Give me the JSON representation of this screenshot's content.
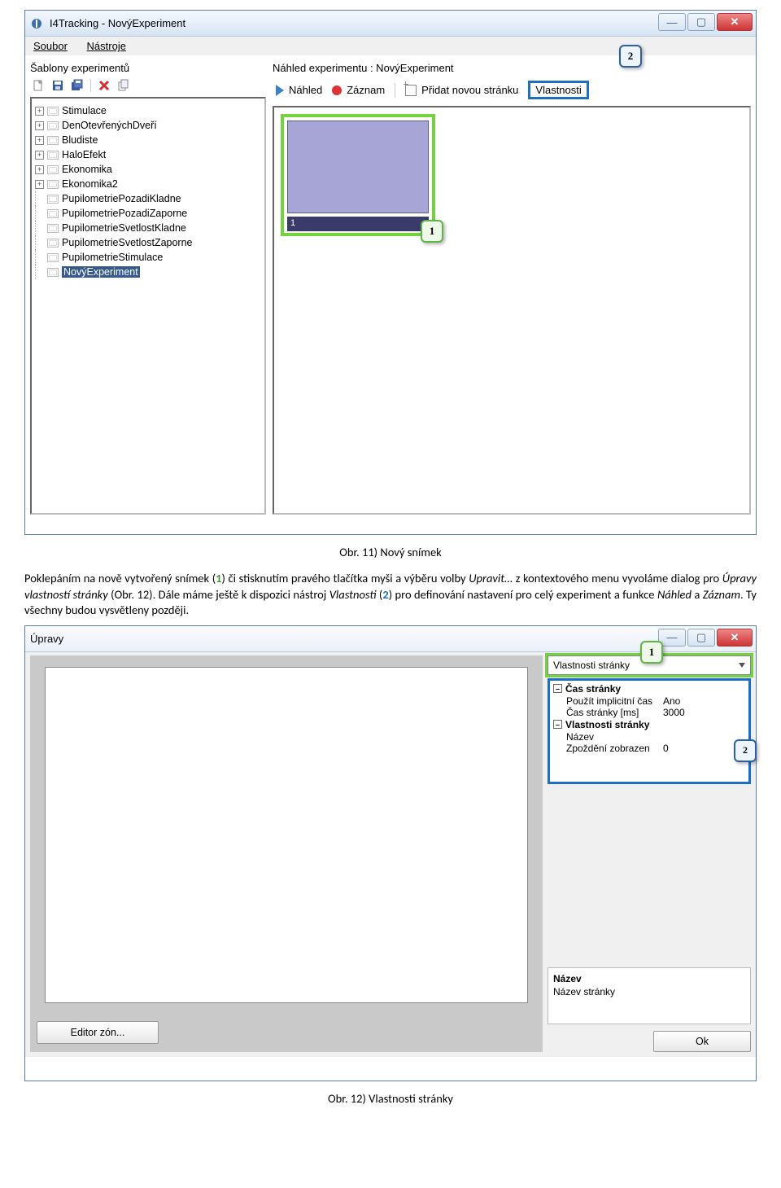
{
  "fig1": {
    "window_title": "I4Tracking - NovýExperiment",
    "menu": {
      "file": "Soubor",
      "tools": "Nástroje"
    },
    "left_panel_label": "Šablony experimentů",
    "right_panel_label": "Náhled experimentu : NovýExperiment",
    "tree_items": [
      {
        "label": "Stimulace",
        "expandable": true
      },
      {
        "label": "DenOtevřenýchDveří",
        "expandable": true
      },
      {
        "label": "Bludiste",
        "expandable": true
      },
      {
        "label": "HaloEfekt",
        "expandable": true
      },
      {
        "label": "Ekonomika",
        "expandable": true
      },
      {
        "label": "Ekonomika2",
        "expandable": true
      },
      {
        "label": "PupilometriePozadiKladne",
        "expandable": false
      },
      {
        "label": "PupilometriePozadiZaporne",
        "expandable": false
      },
      {
        "label": "PupilometrieSvetlostKladne",
        "expandable": false
      },
      {
        "label": "PupilometrieSvetlostZaporne",
        "expandable": false
      },
      {
        "label": "PupilometrieStimulace",
        "expandable": false
      },
      {
        "label": "NovýExperiment",
        "expandable": false,
        "selected": true
      }
    ],
    "toolbar_right": {
      "preview": "Náhled",
      "record": "Záznam",
      "add_page": "Přidat novou stránku",
      "properties": "Vlastnosti"
    },
    "thumb_index": "1",
    "callouts": {
      "thumb": "1",
      "properties": "2"
    },
    "caption": "Obr. 11) Nový snímek"
  },
  "body_text": {
    "p1a": "Poklepáním na nově vytvořený snímek (",
    "p1_num1": "1",
    "p1b": ") či stisknutím pravého tlačítka myši a výběru volby ",
    "p1_upravit": "Upravit…",
    "p1c": " z kontextového menu vyvoláme dialog pro ",
    "p1_upravy": "Úpravy vlastností stránky",
    "p1d": " (Obr. 12). Dále máme ještě k dispozici nástroj ",
    "p1_vlast": "Vlastnosti",
    "p1e": " (",
    "p1_num2": "2",
    "p1f": ") pro definování nastavení pro celý experiment a funkce ",
    "p1_nahled": "Náhled",
    "p1g": " a ",
    "p1_zaznam": "Záznam",
    "p1h": ". Ty všechny budou vysvětleny později."
  },
  "fig2": {
    "window_title": "Úpravy",
    "dropdown_label": "Vlastnosti stránky",
    "propgrid": {
      "group1": "Čas stránky",
      "rows1": [
        {
          "k": "Použít implicitní čas",
          "v": "Ano"
        },
        {
          "k": "Čas stránky [ms]",
          "v": "3000"
        }
      ],
      "group2": "Vlastnosti stránky",
      "rows2": [
        {
          "k": "Název",
          "v": ""
        },
        {
          "k": "Zpoždění zobrazen",
          "v": "0"
        }
      ]
    },
    "desc": {
      "header": "Název",
      "body": "Název stránky"
    },
    "editor_btn": "Editor zón...",
    "ok_btn": "Ok",
    "callouts": {
      "dropdown": "1",
      "grid": "2"
    },
    "caption": "Obr. 12) Vlastnosti stránky"
  }
}
